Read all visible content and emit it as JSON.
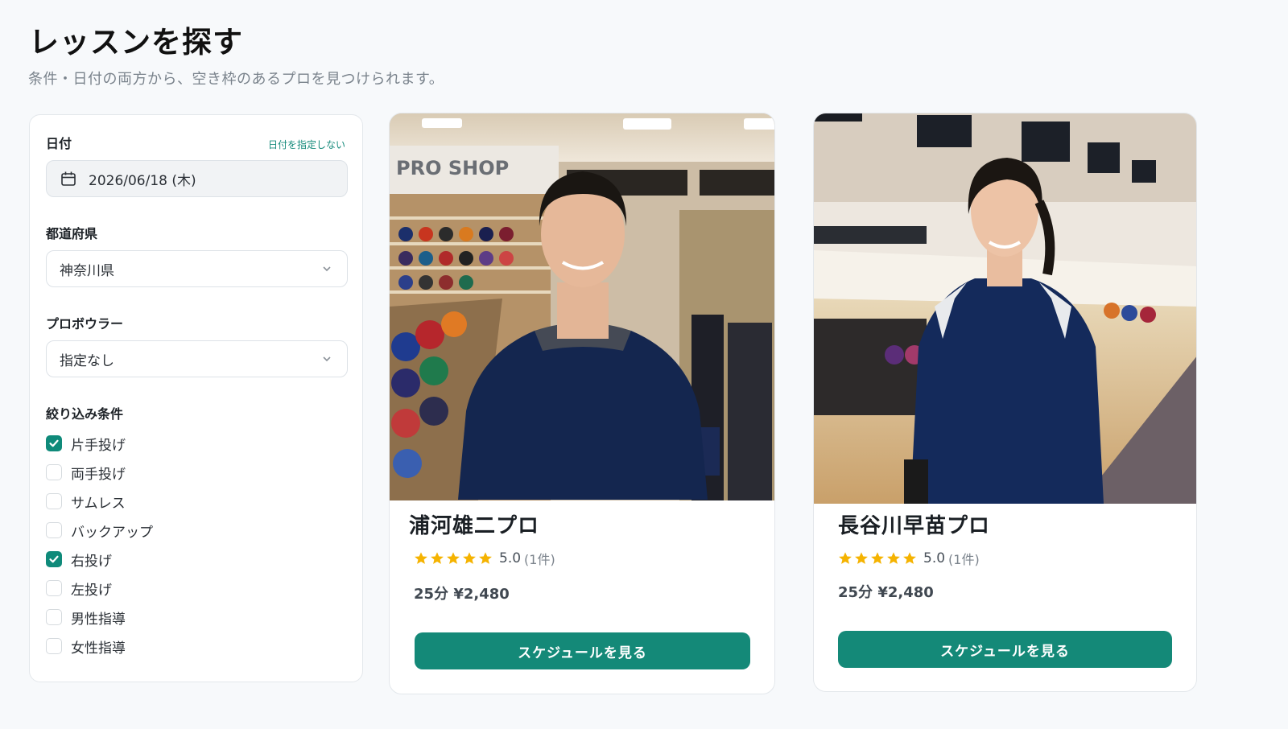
{
  "page": {
    "title": "レッスンを探す",
    "subtitle": "条件・日付の両方から、空き枠のあるプロを見つけられます。"
  },
  "filters": {
    "date": {
      "label": "日付",
      "clear_label": "日付を指定しない",
      "value": "2026/06/18 (木)",
      "icon": "calendar-icon"
    },
    "prefecture": {
      "label": "都道府県",
      "value": "神奈川県",
      "icon": "chevron-down-icon"
    },
    "bowler": {
      "label": "プロボウラー",
      "value": "指定なし",
      "icon": "chevron-down-icon"
    },
    "conditions": {
      "label": "絞り込み条件",
      "items": [
        {
          "label": "片手投げ",
          "checked": true
        },
        {
          "label": "両手投げ",
          "checked": false
        },
        {
          "label": "サムレス",
          "checked": false
        },
        {
          "label": "バックアップ",
          "checked": false
        },
        {
          "label": "右投げ",
          "checked": true
        },
        {
          "label": "左投げ",
          "checked": false
        },
        {
          "label": "男性指導",
          "checked": false
        },
        {
          "label": "女性指導",
          "checked": false
        }
      ]
    }
  },
  "pros": [
    {
      "name": "浦河雄二プロ",
      "rating": "5.0",
      "review_count": "(1件)",
      "stars": 5,
      "price": "25分 ¥2,480",
      "button_label": "スケジュールを見る",
      "photo_sign": "PRO SHOP"
    },
    {
      "name": "長谷川早苗プロ",
      "rating": "5.0",
      "review_count": "(1件)",
      "stars": 5,
      "price": "25分 ¥2,480",
      "button_label": "スケジュールを見る"
    }
  ],
  "colors": {
    "accent": "#148978",
    "star": "#f5b301",
    "background": "#f7f9fb"
  }
}
